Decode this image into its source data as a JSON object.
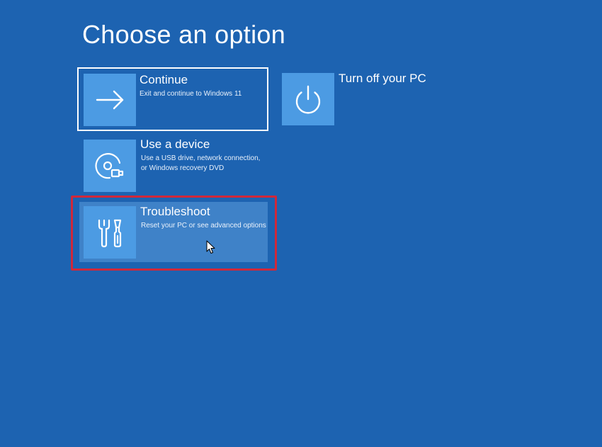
{
  "page": {
    "title": "Choose an option"
  },
  "options": [
    {
      "id": "continue",
      "title": "Continue",
      "description": "Exit and continue to Windows 11",
      "icon": "arrow-right-icon",
      "focused": true
    },
    {
      "id": "use-device",
      "title": "Use a device",
      "description": "Use a USB drive, network connection, or Windows recovery DVD",
      "icon": "disc-device-icon"
    },
    {
      "id": "troubleshoot",
      "title": "Troubleshoot",
      "description": "Reset your PC or see advanced options",
      "icon": "tools-icon",
      "hovered": true,
      "highlighted": true
    },
    {
      "id": "turn-off",
      "title": "Turn off your PC",
      "icon": "power-icon"
    }
  ],
  "colors": {
    "background": "#1d63b1",
    "tile": "#4c9be3",
    "hover": "#3f82c8",
    "highlight_frame": "#d0283a",
    "focus_border": "#ffffff"
  }
}
